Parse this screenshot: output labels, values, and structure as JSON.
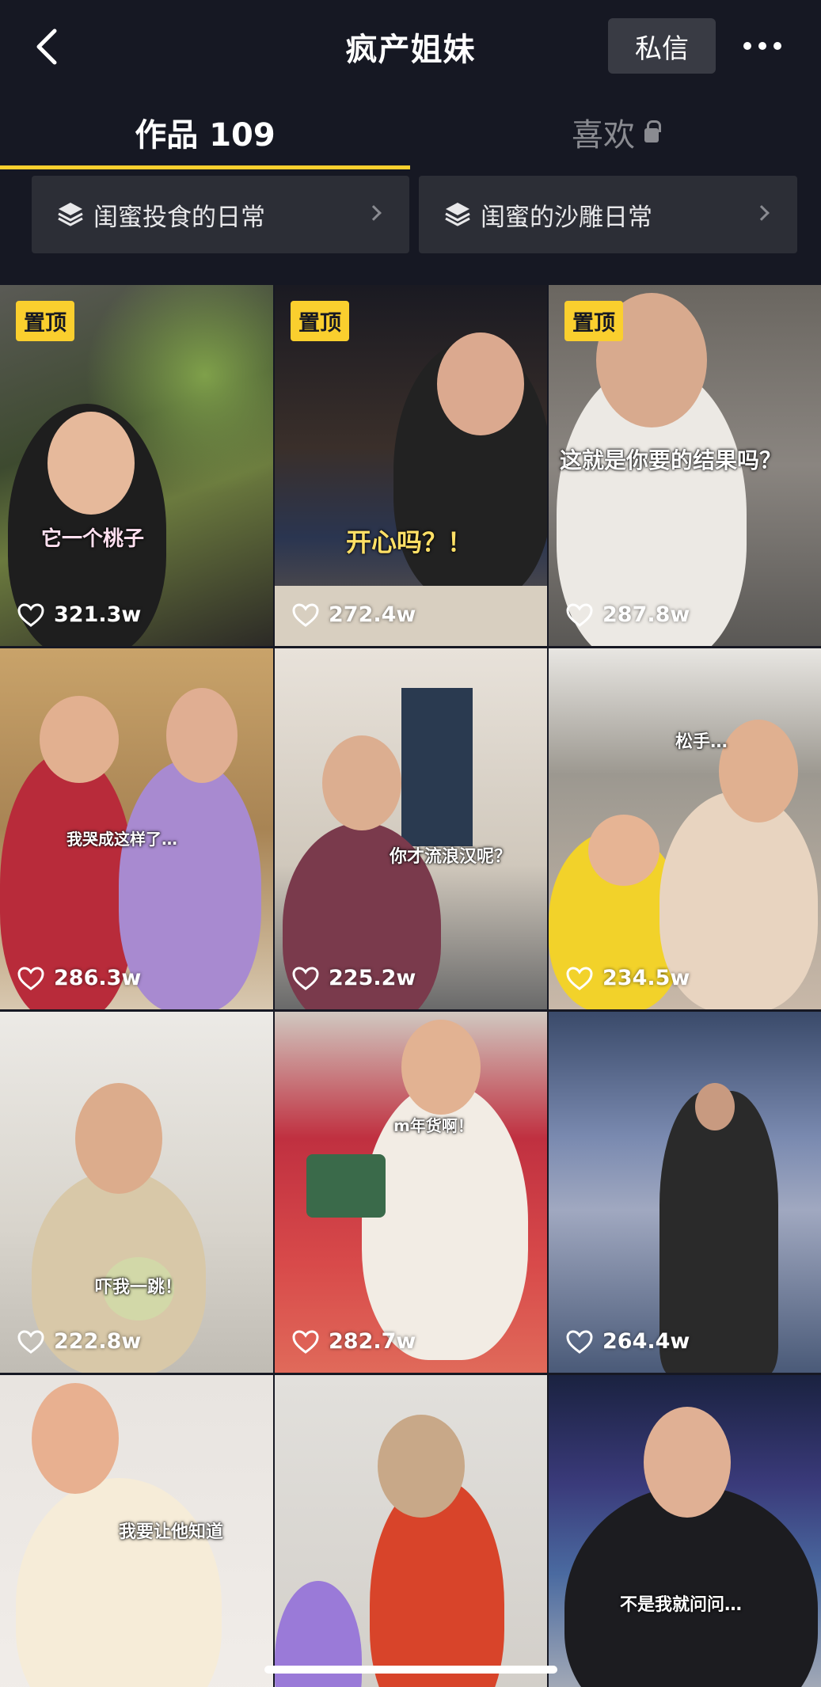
{
  "header": {
    "title": "疯产姐妹",
    "dm_label": "私信",
    "back_icon": "chevron-left-icon",
    "more_icon": "more-dots-icon"
  },
  "tabs": [
    {
      "label": "作品 109",
      "active": true
    },
    {
      "label": "喜欢",
      "active": false,
      "locked": true
    }
  ],
  "collections": [
    {
      "label": "闺蜜投食的日常",
      "icon": "stack-layers-icon"
    },
    {
      "label": "闺蜜的沙雕日常",
      "icon": "stack-layers-icon"
    }
  ],
  "pinned_label": "置顶",
  "videos": [
    {
      "likes": "321.3w",
      "pinned": true,
      "caption": "它一个桃子"
    },
    {
      "likes": "272.4w",
      "pinned": true,
      "caption": "开心吗？！"
    },
    {
      "likes": "287.8w",
      "pinned": true,
      "caption": "这就是你要的结果吗？"
    },
    {
      "likes": "286.3w",
      "pinned": false,
      "caption": "我哭成这样了…"
    },
    {
      "likes": "225.2w",
      "pinned": false,
      "caption": "你才流浪汉呢？"
    },
    {
      "likes": "234.5w",
      "pinned": false,
      "caption": "松手…"
    },
    {
      "likes": "222.8w",
      "pinned": false,
      "caption": "吓我一跳！"
    },
    {
      "likes": "282.7w",
      "pinned": false,
      "caption": "m年货啊！"
    },
    {
      "likes": "264.4w",
      "pinned": false,
      "caption": ""
    },
    {
      "likes": "",
      "pinned": false,
      "caption": "我要让他知道"
    },
    {
      "likes": "",
      "pinned": false,
      "caption": ""
    },
    {
      "likes": "",
      "pinned": false,
      "caption": "不是我就问问…"
    }
  ],
  "colors": {
    "background": "#161823",
    "accent": "#facf2e",
    "button_bg": "#393b44",
    "collection_bg": "#2c2e36",
    "muted_text": "#8a8b91"
  }
}
